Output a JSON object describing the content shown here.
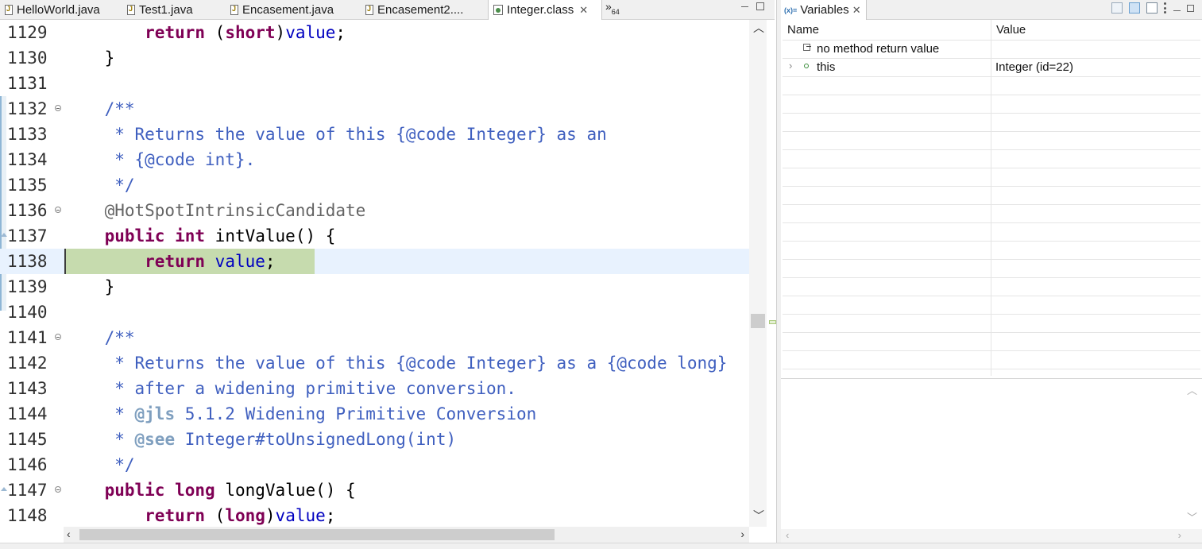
{
  "editor_tabs": [
    {
      "label": "HelloWorld.java",
      "active": false
    },
    {
      "label": "Test1.java",
      "active": false
    },
    {
      "label": "Encasement.java",
      "active": false
    },
    {
      "label": "Encasement2....",
      "active": false
    },
    {
      "label": "Integer.class",
      "active": true
    }
  ],
  "tab_overflow": {
    "symbol": "»",
    "count": "64"
  },
  "code": {
    "current_line": "1138",
    "lines": [
      {
        "n": "1129",
        "fold": false
      },
      {
        "n": "1130",
        "fold": false
      },
      {
        "n": "1131",
        "fold": false
      },
      {
        "n": "1132",
        "fold": true
      },
      {
        "n": "1133",
        "fold": false
      },
      {
        "n": "1134",
        "fold": false
      },
      {
        "n": "1135",
        "fold": false
      },
      {
        "n": "1136",
        "fold": true
      },
      {
        "n": "1137",
        "fold": false
      },
      {
        "n": "1138",
        "fold": false
      },
      {
        "n": "1139",
        "fold": false
      },
      {
        "n": "1140",
        "fold": false
      },
      {
        "n": "1141",
        "fold": true
      },
      {
        "n": "1142",
        "fold": false
      },
      {
        "n": "1143",
        "fold": false
      },
      {
        "n": "1144",
        "fold": false
      },
      {
        "n": "1145",
        "fold": false
      },
      {
        "n": "1146",
        "fold": false
      },
      {
        "n": "1147",
        "fold": true
      },
      {
        "n": "1148",
        "fold": false
      }
    ],
    "tokens": {
      "l1129": [
        "        ",
        "return",
        " (",
        "short",
        ")",
        "value",
        ";"
      ],
      "l1130": "    }",
      "l1132": "    /**",
      "l1133": [
        "     * Returns the value of this {@code Integer} as an"
      ],
      "l1134": [
        "     * {@code int}."
      ],
      "l1135": "     */",
      "l1136": "    @HotSpotIntrinsicCandidate",
      "l1137": [
        "    ",
        "public",
        " ",
        "int",
        " intValue() {"
      ],
      "l1138": [
        "        ",
        "return",
        " ",
        "value",
        ";"
      ],
      "l1139": "    }",
      "l1141": "    /**",
      "l1142": [
        "     * Returns the value of this {@code Integer} as a {@code long}"
      ],
      "l1143": [
        "     * after a widening primitive conversion."
      ],
      "l1144": [
        "     * ",
        "@jls",
        " 5.1.2 Widening Primitive Conversion"
      ],
      "l1145": [
        "     * ",
        "@see",
        " Integer#toUnsignedLong(int)"
      ],
      "l1146": "     */",
      "l1147": [
        "    ",
        "public",
        " ",
        "long",
        " longValue() {"
      ],
      "l1148": [
        "        ",
        "return",
        " (",
        "long",
        ")",
        "value",
        ";"
      ]
    }
  },
  "variables_view": {
    "tab_label": "Variables",
    "tab_icon": "(x)=",
    "columns": {
      "name": "Name",
      "value": "Value"
    },
    "rows": [
      {
        "name": "no method return value",
        "value": "",
        "icon": "method-return-icon",
        "expandable": false
      },
      {
        "name": "this",
        "value": "Integer  (id=22)",
        "icon": "object-icon",
        "expandable": true
      }
    ]
  },
  "colors": {
    "keyword": "#7f0055",
    "field": "#0000c0",
    "javadoc": "#3f5fbf",
    "javadoc_tag": "#7f9fbf",
    "annotation": "#646464",
    "current_line_bg": "#e8f2fe",
    "debug_line_bg": "#c6dbae"
  }
}
